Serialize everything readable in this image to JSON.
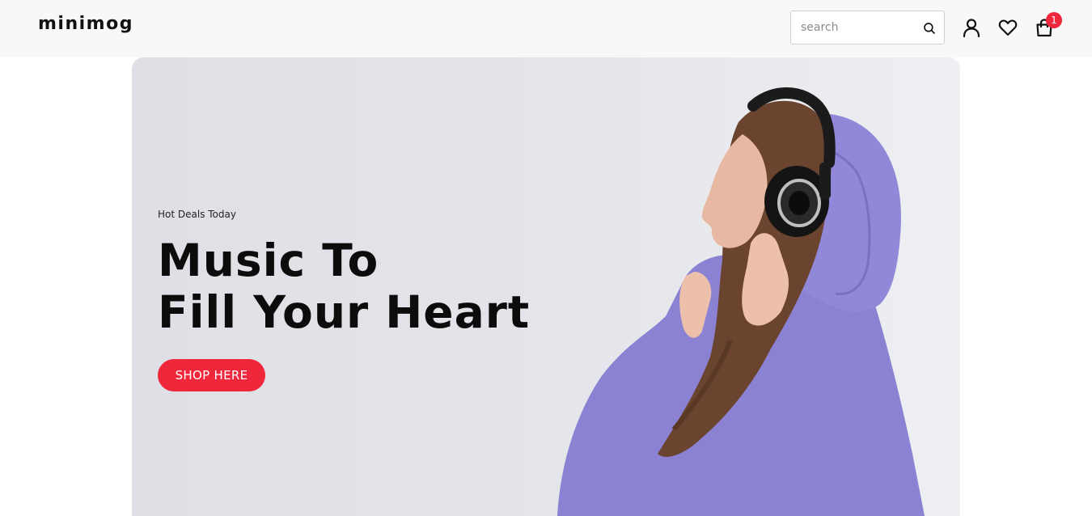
{
  "header": {
    "logo": "minimog",
    "search_placeholder": "search",
    "icons": [
      "search-icon",
      "user-icon",
      "heart-icon",
      "cart-icon"
    ],
    "cart_count": "1"
  },
  "hero": {
    "eyebrow": "Hot Deals Today",
    "title_line1": "Music To",
    "title_line2": "Fill Your Heart",
    "cta_label": "SHOP HERE",
    "image": "woman-with-headphones"
  },
  "colors": {
    "accent": "#f0263a",
    "hero_bg": "#e3e5ea",
    "hoodie": "#8b82d4",
    "header_bg": "#f8f8f8"
  }
}
